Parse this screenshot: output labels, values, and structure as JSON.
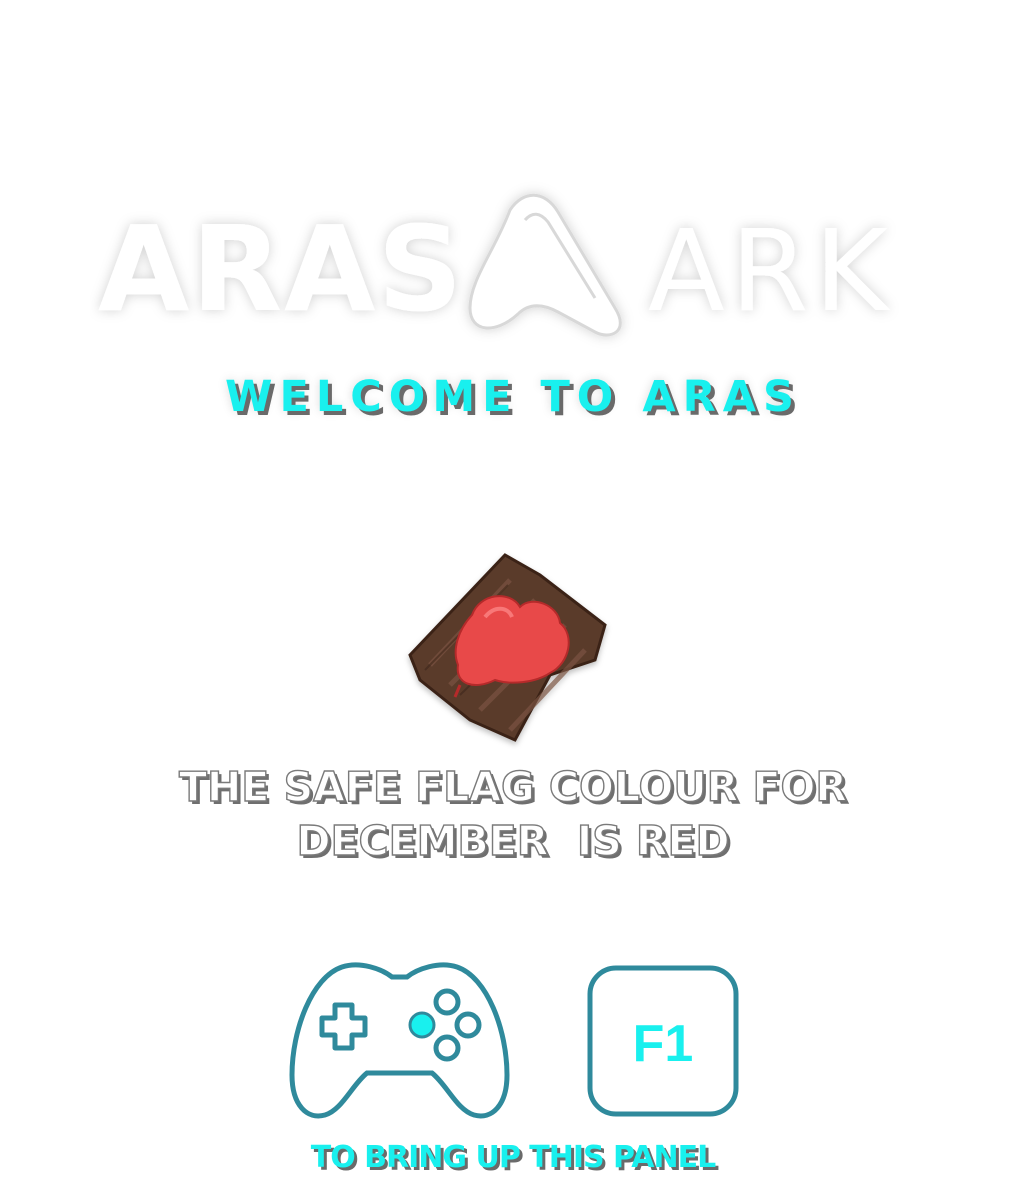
{
  "logo": {
    "left_text": "ARAS",
    "right_text": "ARK"
  },
  "welcome": "WELCOME TO ARAS",
  "flag_icon": "red-flag-on-wooden-board-icon",
  "safe_flag": {
    "line1": "THE SAFE FLAG COLOUR FOR",
    "line2": "DECEMBER  IS RED"
  },
  "controls": {
    "gamepad_icon": "gamepad-icon",
    "key_label": "F1"
  },
  "hint": "TO BRING UP THIS PANEL",
  "colors": {
    "accent_cyan": "#19f0ee",
    "icon_teal": "#2f8a9c",
    "flag_red": "#e84a4a",
    "wood_brown": "#5a3b2b"
  }
}
